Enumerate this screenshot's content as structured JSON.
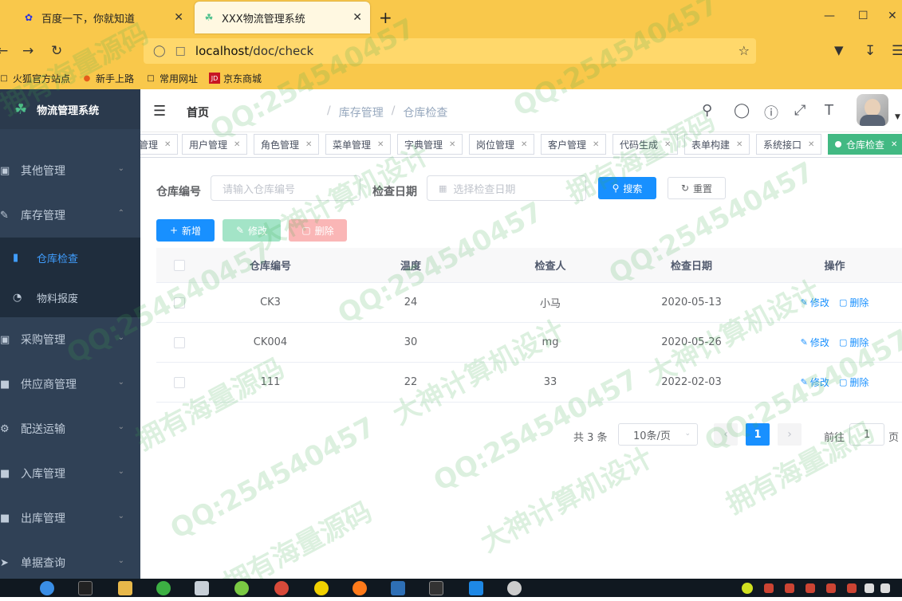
{
  "browser": {
    "tabs": [
      {
        "title": "百度一下，你就知道",
        "icon": "paw-icon",
        "active": false
      },
      {
        "title": "XXX物流管理系统",
        "icon": "leaf-icon",
        "active": true
      }
    ],
    "url_host": "localhost",
    "url_path": "/doc/check",
    "bookmarks": [
      "火狐官方站点",
      "新手上路",
      "常用网址",
      "京东商城"
    ]
  },
  "app": {
    "title": "物流管理系统",
    "accent": "#1890ff",
    "sidebar_bg": "#304156"
  },
  "sidebar": {
    "items": [
      {
        "label": "其他管理",
        "icon": "grid-icon"
      },
      {
        "label": "库存管理",
        "icon": "edit-icon",
        "expanded": true
      },
      {
        "label": "采购管理",
        "icon": "cart-icon"
      },
      {
        "label": "供应商管理",
        "icon": "shirt-icon"
      },
      {
        "label": "配送运输",
        "icon": "gear-icon"
      },
      {
        "label": "入库管理",
        "icon": "shirt-icon"
      },
      {
        "label": "出库管理",
        "icon": "shirt-icon"
      },
      {
        "label": "单据查询",
        "icon": "send-icon"
      }
    ],
    "sub_items": [
      {
        "label": "仓库检查",
        "icon": "chat-icon",
        "active": true
      },
      {
        "label": "物料报废",
        "icon": "dashboard-icon",
        "active": false
      }
    ]
  },
  "breadcrumb": [
    "首页",
    "库存管理",
    "仓库检查"
  ],
  "tags": [
    {
      "label": "管理"
    },
    {
      "label": "用户管理"
    },
    {
      "label": "角色管理"
    },
    {
      "label": "菜单管理"
    },
    {
      "label": "字典管理"
    },
    {
      "label": "岗位管理"
    },
    {
      "label": "客户管理"
    },
    {
      "label": "代码生成"
    },
    {
      "label": "表单构建"
    },
    {
      "label": "系统接口"
    },
    {
      "label": "仓库检查",
      "active": true
    }
  ],
  "query": {
    "warehouse_label": "仓库编号",
    "warehouse_placeholder": "请输入仓库编号",
    "date_label": "检查日期",
    "date_placeholder": "选择检查日期",
    "search_label": "搜索",
    "reset_label": "重置"
  },
  "toolbar": {
    "add_label": "新增",
    "edit_label": "修改",
    "delete_label": "删除"
  },
  "table": {
    "columns": [
      "仓库编号",
      "温度",
      "检查人",
      "检查日期",
      "操作"
    ],
    "rows": [
      {
        "code": "CK3",
        "temp": "24",
        "inspector": "小马",
        "date": "2020-05-13"
      },
      {
        "code": "CK004",
        "temp": "30",
        "inspector": "mg",
        "date": "2020-05-26"
      },
      {
        "code": "111",
        "temp": "22",
        "inspector": "33",
        "date": "2022-02-03"
      }
    ],
    "row_edit": "修改",
    "row_delete": "删除"
  },
  "pagination": {
    "total_text": "共 3 条",
    "page_size": "10条/页",
    "current_page": "1",
    "goto_label": "前往",
    "goto_value": "1",
    "page_suffix": "页"
  },
  "watermarks": [
    "QQ:254540457",
    "大神计算机设计",
    "拥有海量源码"
  ]
}
